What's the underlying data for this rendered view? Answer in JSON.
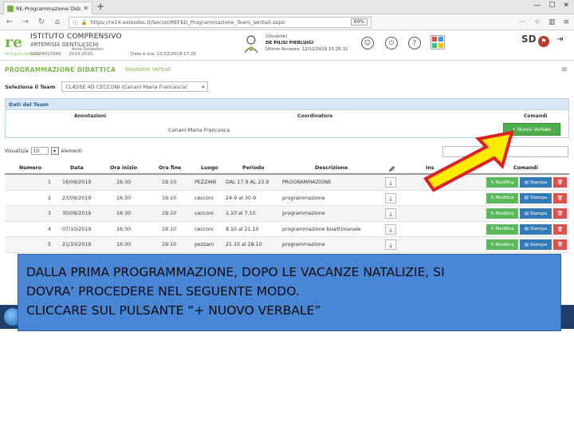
{
  "browser": {
    "tab_title": "RE-Programmazione Didattica",
    "url": "https://re14.axiosdoc.it/Secret/REFED_Programmazione_Team_Verbali.aspx",
    "zoom": "90%"
  },
  "header": {
    "school_line1": "ISTITUTO COMPRENSIVO",
    "school_line2": "ARTEMISIA GENTILESCHI",
    "code1": "50204010989",
    "anno_label": "Anno Scolastico",
    "anno": "2019-2020",
    "date_line": "Data e ora: 12/12/2019 17:26",
    "user_role": "(Docente)",
    "user_name": "DE PILISI PIERLUIGI",
    "user_detail": "Ultimo Accesso: 12/12/2019 15:25:31",
    "logo_sub": "RE Registro Elettronico",
    "brand": "SD"
  },
  "module": {
    "title": "PROGRAMMAZIONE DIDATTICA",
    "section": "Gestione Verbali"
  },
  "team_select": {
    "label": "Seleziona il Team",
    "value": "CLASSE 4D CECCONI (Canani Maria Francesca)"
  },
  "team_panel": {
    "title": "Dati del Team",
    "col_annotazioni": "Annotazioni",
    "col_coordinatore": "Coordinatore",
    "col_comandi": "Comandi",
    "coordinatore": "Canani Maria Francesca",
    "new_button": "+ Nuovo Verbale"
  },
  "entries": {
    "prefix": "Visualizza",
    "count": "10",
    "suffix": "elementi"
  },
  "table": {
    "headers": {
      "numero": "Numero",
      "data": "Data",
      "ora_inizio": "Ora inizio",
      "ora_fine": "Ora fine",
      "luogo": "Luogo",
      "periodo": "Periodo",
      "descrizione": "Descrizione",
      "clip": "🖉",
      "ins": "Ins",
      "comandi": "Comandi"
    },
    "rows": [
      {
        "numero": "1",
        "data": "16/09/2019",
        "inizio": "16:30",
        "fine": "19:10",
        "luogo": "PEZZANI",
        "periodo": "DAL 17.9 AL 23.9",
        "descrizione": "PROGRAMMAZIONE"
      },
      {
        "numero": "2",
        "data": "23/09/2019",
        "inizio": "16:30",
        "fine": "19:10",
        "luogo": "cecconi",
        "periodo": "24-9 al 30-9",
        "descrizione": "programmazione"
      },
      {
        "numero": "3",
        "data": "30/09/2019",
        "inizio": "16:30",
        "fine": "19:10",
        "luogo": "cecconi",
        "periodo": "1.10 al 7.10",
        "descrizione": "programmazione"
      },
      {
        "numero": "4",
        "data": "07/10/2019",
        "inizio": "16:30",
        "fine": "19:10",
        "luogo": "cecconi",
        "periodo": "8.10 al 21.10",
        "descrizione": "programmazione bisettimanale"
      },
      {
        "numero": "5",
        "data": "21/10/2019",
        "inizio": "16:30",
        "fine": "19:10",
        "luogo": "pezzani",
        "periodo": "21.10 al 28.10",
        "descrizione": "programmazione"
      }
    ],
    "btn_modifica": "Modifica",
    "btn_stampa": "Stampa"
  },
  "caption": {
    "line1": "DALLA PRIMA PROGRAMMAZIONE, DOPO LE VACANZE NATALIZIE, SI",
    "line2": "DOVRA’ PROCEDERE NEL SEGUENTE MODO.",
    "line3": "CLICCARE SUL PULSANTE “+ NUOVO VERBALE”"
  },
  "colors": {
    "green": "#5cb85c",
    "blue": "#337ab7",
    "red": "#d9534f",
    "arrow_yellow": "#ffeb00",
    "arrow_red": "#e02020",
    "caption_bg": "#4a86d6"
  }
}
